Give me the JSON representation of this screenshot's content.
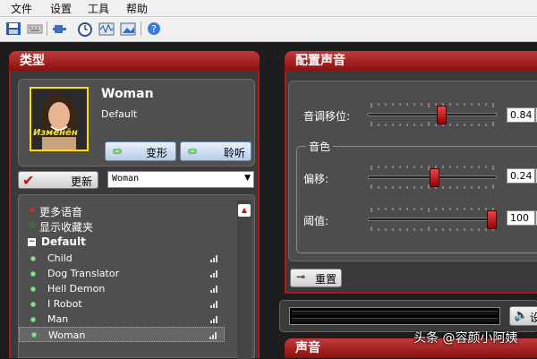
{
  "menu": {
    "items": [
      "文件",
      "设置",
      "工具",
      "帮助"
    ]
  },
  "toolbar": {
    "icons": [
      "save-icon",
      "keyboard-icon",
      "plugin-icon",
      "clock-icon",
      "waveform-icon",
      "image-icon",
      "help-icon"
    ]
  },
  "type_panel": {
    "title": "类型",
    "voice_name": "Woman",
    "voice_sub": "Default",
    "portrait_caption": "Изменён",
    "morph_label": "变形",
    "listen_label": "聆听",
    "update_label": "更新",
    "dropdown_value": "Woman",
    "list": {
      "more_voices": "更多语音",
      "show_favorites": "显示收藏夹",
      "group": "Default",
      "items": [
        "Child",
        "Dog Translator",
        "Hell Demon",
        "I Robot",
        "Man",
        "Woman"
      ],
      "selected": "Woman"
    }
  },
  "config_panel": {
    "title": "配置声音",
    "pitch": {
      "label": "音调移位:",
      "value": "0.84",
      "level": 0.58
    },
    "timbre_group": "音色",
    "offset": {
      "label": "偏移:",
      "value": "0.24",
      "level": 0.52
    },
    "threshold": {
      "label": "阈值:",
      "value": "100",
      "level": 1.0
    },
    "reset_label": "重置"
  },
  "output": {
    "speaker_label": "设"
  },
  "sound_panel": {
    "title": "声音"
  },
  "watermark": "头条 @容颜小阿姨",
  "colors": {
    "accent_red": "#b01818",
    "panel_bg": "#3a3a3a",
    "inner_bg": "#515151"
  }
}
